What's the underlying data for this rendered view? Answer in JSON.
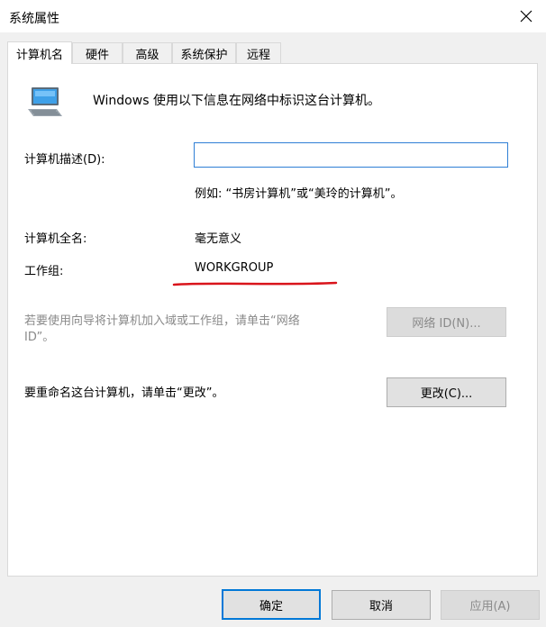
{
  "window": {
    "title": "系统属性"
  },
  "tabs": [
    {
      "label": "计算机名",
      "active": true
    },
    {
      "label": "硬件",
      "active": false
    },
    {
      "label": "高级",
      "active": false
    },
    {
      "label": "系统保护",
      "active": false
    },
    {
      "label": "远程",
      "active": false
    }
  ],
  "panel": {
    "intro_text": "Windows 使用以下信息在网络中标识这台计算机。",
    "description_label": "计算机描述(D):",
    "description_value": "",
    "example_text": "例如: “书房计算机”或“美玲的计算机”。",
    "fullname_label": "计算机全名:",
    "fullname_value": "毫无意义",
    "workgroup_label": "工作组:",
    "workgroup_value": "WORKGROUP",
    "network_hint_line1": "若要使用向导将计算机加入域或工作组，请单击“网络",
    "network_hint_line2": "ID”。",
    "network_id_button": "网络 ID(N)...",
    "rename_text": "要重命名这台计算机，请单击“更改”。",
    "change_button": "更改(C)..."
  },
  "footer": {
    "ok": "确定",
    "cancel": "取消",
    "apply": "应用(A)"
  },
  "colors": {
    "accent": "#0078d7",
    "annotation_red": "#d9141b",
    "disabled_text": "#8a8a8a"
  }
}
